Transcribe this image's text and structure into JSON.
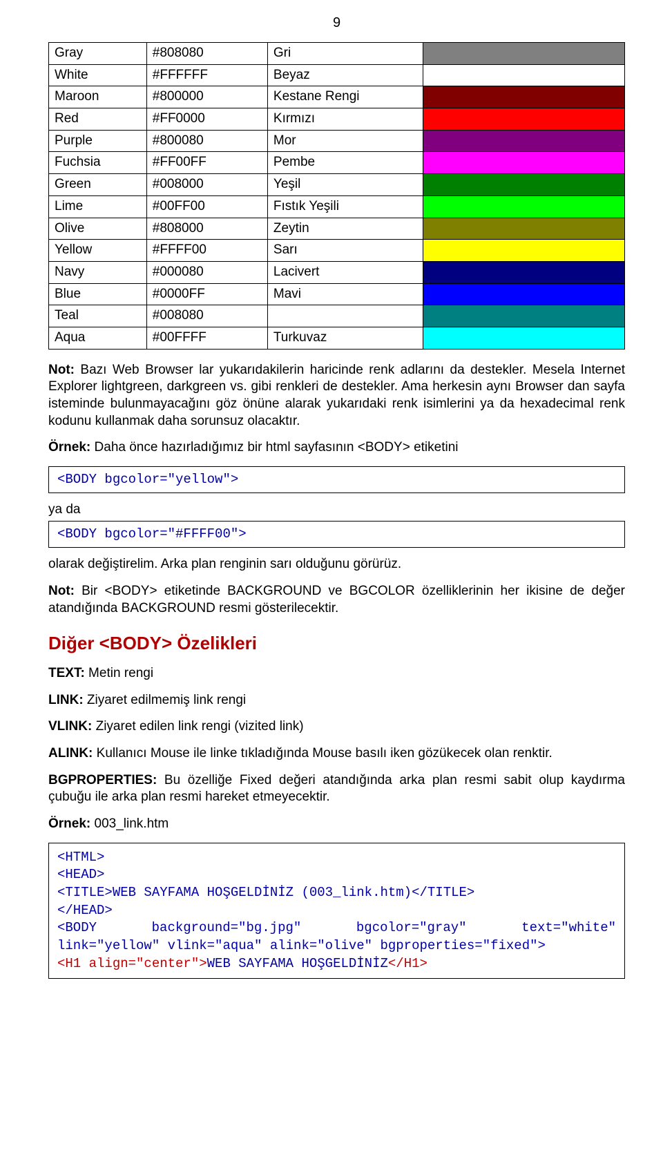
{
  "page_number": "9",
  "colors": [
    {
      "name": "Gray",
      "code": "#808080",
      "tr": "Gri",
      "hex": "#808080"
    },
    {
      "name": "White",
      "code": "#FFFFFF",
      "tr": "Beyaz",
      "hex": "#FFFFFF"
    },
    {
      "name": "Maroon",
      "code": "#800000",
      "tr": "Kestane Rengi",
      "hex": "#800000"
    },
    {
      "name": "Red",
      "code": "#FF0000",
      "tr": "Kırmızı",
      "hex": "#FF0000"
    },
    {
      "name": "Purple",
      "code": "#800080",
      "tr": "Mor",
      "hex": "#800080"
    },
    {
      "name": "Fuchsia",
      "code": "#FF00FF",
      "tr": "Pembe",
      "hex": "#FF00FF"
    },
    {
      "name": "Green",
      "code": "#008000",
      "tr": "Yeşil",
      "hex": "#008000"
    },
    {
      "name": "Lime",
      "code": "#00FF00",
      "tr": "Fıstık Yeşili",
      "hex": "#00FF00"
    },
    {
      "name": "Olive",
      "code": "#808000",
      "tr": "Zeytin",
      "hex": "#808000"
    },
    {
      "name": "Yellow",
      "code": "#FFFF00",
      "tr": "Sarı",
      "hex": "#FFFF00"
    },
    {
      "name": "Navy",
      "code": "#000080",
      "tr": "Lacivert",
      "hex": "#000080"
    },
    {
      "name": "Blue",
      "code": "#0000FF",
      "tr": "Mavi",
      "hex": "#0000FF"
    },
    {
      "name": "Teal",
      "code": "#008080",
      "tr": "",
      "hex": "#008080"
    },
    {
      "name": "Aqua",
      "code": "#00FFFF",
      "tr": "Turkuvaz",
      "hex": "#00FFFF"
    }
  ],
  "note1_label": "Not:",
  "note1_text": " Bazı Web Browser lar yukarıdakilerin haricinde renk adlarını da destekler. Mesela Internet Explorer lightgreen, darkgreen vs. gibi renkleri de destekler. Ama herkesin aynı Browser dan sayfa isteminde bulunmayacağını göz önüne alarak yukarıdaki renk isimlerini ya da hexadecimal renk kodunu kullanmak daha sorunsuz olacaktır.",
  "example1_label": "Örnek:",
  "example1_text": " Daha önce hazırladığımız bir html sayfasının <BODY> etiketini",
  "code1": "<BODY bgcolor=\"yellow\">",
  "yada": "ya da",
  "code2": "<BODY bgcolor=\"#FFFF00\">",
  "after_code": "olarak değiştirelim. Arka plan renginin sarı olduğunu görürüz.",
  "note2_label": "Not:",
  "note2_text": " Bir <BODY> etiketinde BACKGROUND ve BGCOLOR özelliklerinin her ikisine de değer atandığında BACKGROUND resmi gösterilecektir.",
  "heading": "Diğer <BODY> Özelikleri",
  "prop_text_label": "TEXT:",
  "prop_text": " Metin rengi",
  "prop_link_label": "LINK:",
  "prop_link": " Ziyaret edilmemiş link rengi",
  "prop_vlink_label": "VLINK:",
  "prop_vlink": " Ziyaret edilen link rengi (vizited link)",
  "prop_alink_label": "ALINK:",
  "prop_alink": " Kullanıcı Mouse ile linke tıkladığında Mouse basılı iken gözükecek olan renktir.",
  "prop_bgprop_label": "BGPROPERTIES:",
  "prop_bgprop": " Bu özelliğe Fixed değeri atandığında arka plan resmi sabit olup kaydırma çubuğu ile arka plan resmi hareket etmeyecektir.",
  "example2_label": "Örnek:",
  "example2_text": " 003_link.htm",
  "codebox": {
    "l1": "<HTML>",
    "l2": "<HEAD>",
    "l3": "<TITLE>WEB SAYFAMA HOŞGELDİNİZ (003_link.htm)</TITLE>",
    "l4": "</HEAD>",
    "l5a": "<BODY",
    "l5b": "background=\"bg.jpg\"",
    "l5c": "bgcolor=\"gray\"",
    "l5d": "text=\"white\"",
    "l6": "link=\"yellow\" vlink=\"aqua\" alink=\"olive\" bgproperties=\"fixed\">",
    "l7a": "<H1 align=\"center\">",
    "l7b": "WEB SAYFAMA HOŞGELDİNİZ",
    "l7c": "</H1>"
  }
}
